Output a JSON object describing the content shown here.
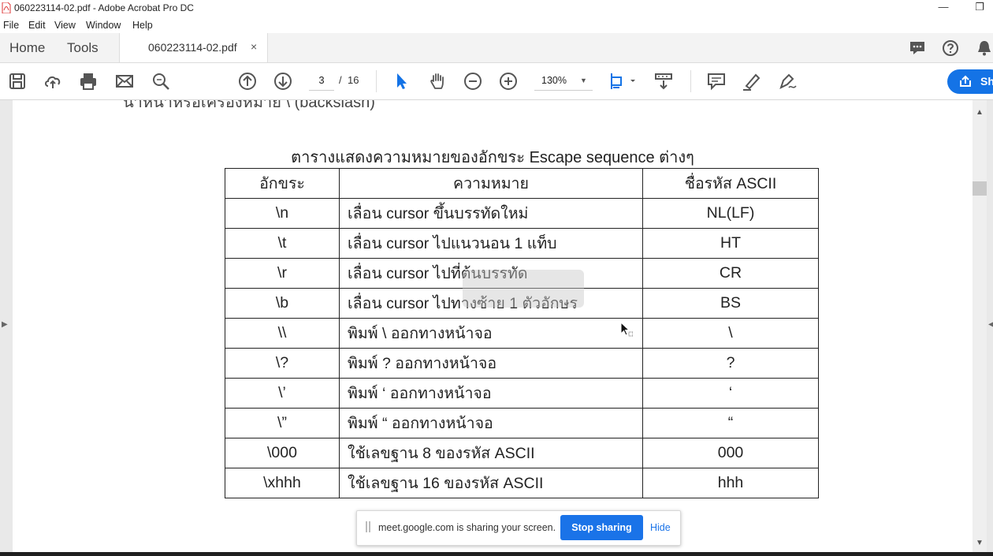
{
  "window": {
    "title": "060223114-02.pdf - Adobe Acrobat Pro DC",
    "minimize": "—",
    "restore": "❐"
  },
  "menu": [
    "File",
    "Edit",
    "View",
    "Window",
    "Help"
  ],
  "tabs": {
    "home": "Home",
    "tools": "Tools",
    "document": "060223114-02.pdf",
    "close": "×"
  },
  "toolbar": {
    "current_page": "3",
    "separator": "/",
    "total_pages": "16",
    "zoom": "130%",
    "share_label": "Sh",
    "colors": {
      "accent": "#1473e6",
      "icon": "#555555"
    }
  },
  "document": {
    "cut_text": "นำหน้าหรือเครื่องหมาย \\ (backslash)",
    "caption": "ตารางแสดงความหมายของอักขระ Escape sequence ต่างๆ",
    "table": {
      "headers": [
        "อักขระ",
        "ความหมาย",
        "ชื่อรหัส ASCII"
      ],
      "rows": [
        [
          "\\n",
          "เลื่อน cursor ขึ้นบรรทัดใหม่",
          "NL(LF)"
        ],
        [
          "\\t",
          "เลื่อน cursor ไปแนวนอน 1 แท็บ",
          "HT"
        ],
        [
          "\\r",
          "เลื่อน cursor ไปที่ต้นบรรทัด",
          "CR"
        ],
        [
          "\\b",
          "เลื่อน cursor ไปทางซ้าย 1 ตัวอักษร",
          "BS"
        ],
        [
          "\\\\",
          "พิมพ์ \\ ออกทางหน้าจอ",
          "\\"
        ],
        [
          "\\?",
          "พิมพ์ ? ออกทางหน้าจอ",
          "?"
        ],
        [
          "\\’",
          "พิมพ์ ‘ ออกทางหน้าจอ",
          "‘"
        ],
        [
          "\\”",
          "พิมพ์ “ ออกทางหน้าจอ",
          "“"
        ],
        [
          "\\000",
          "ใช้เลขฐาน 8 ของรหัส ASCII",
          "000"
        ],
        [
          "\\xhhh",
          "ใช้เลขฐาน 16 ของรหัส ASCII",
          "hhh"
        ]
      ]
    }
  },
  "screen_share": {
    "message": "meet.google.com is sharing your screen.",
    "stop_label": "Stop sharing",
    "hide_label": "Hide",
    "color": "#1a73e8"
  },
  "scrollbar": {
    "up": "▲",
    "down": "▼"
  },
  "side_arrows": {
    "left": "▶",
    "right": "◀"
  }
}
